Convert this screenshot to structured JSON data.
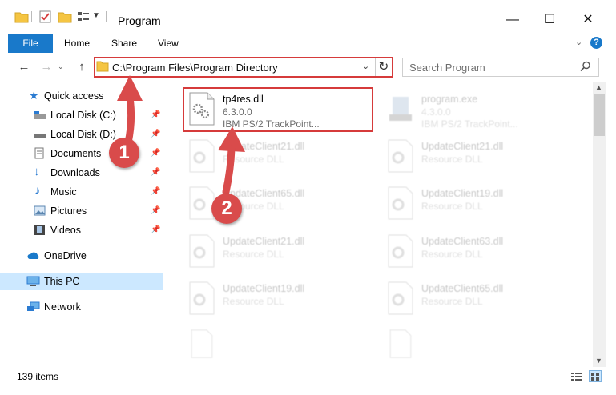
{
  "window": {
    "title": "Program",
    "minimize": "—",
    "maximize": "☐",
    "close": "✕"
  },
  "ribbon": {
    "file": "File",
    "home": "Home",
    "share": "Share",
    "view": "View",
    "help": "?"
  },
  "nav": {
    "back": "←",
    "forward": "→",
    "up": "↑",
    "address": "C:\\Program Files\\Program Directory",
    "refresh": "↻",
    "search_placeholder": "Search Program"
  },
  "sidebar": {
    "items": [
      {
        "label": "Quick access"
      },
      {
        "label": "Local Disk (C:)"
      },
      {
        "label": "Local Disk (D:)"
      },
      {
        "label": "Documents"
      },
      {
        "label": "Downloads"
      },
      {
        "label": "Music"
      },
      {
        "label": "Pictures"
      },
      {
        "label": "Videos"
      },
      {
        "label": "OneDrive"
      },
      {
        "label": "This PC"
      },
      {
        "label": "Network"
      }
    ]
  },
  "files": [
    {
      "name": "tp4res.dll",
      "line2": "6.3.0.0",
      "line3": "IBM PS/2 TrackPoint..."
    },
    {
      "name": "program.exe",
      "line2": "4.3.0.0",
      "line3": "IBM PS/2 TrackPoint..."
    },
    {
      "name": "UpdateClient21.dll",
      "line2": "Resource DLL"
    },
    {
      "name": "UpdateClient21.dll",
      "line2": "Resource DLL"
    },
    {
      "name": "UpdateClient65.dll",
      "line2": "Resource DLL"
    },
    {
      "name": "UpdateClient19.dll",
      "line2": "Resource DLL"
    },
    {
      "name": "UpdateClient21.dll",
      "line2": "Resource DLL"
    },
    {
      "name": "UpdateClient63.dll",
      "line2": "Resource DLL"
    },
    {
      "name": "UpdateClient19.dll",
      "line2": "Resource DLL"
    },
    {
      "name": "UpdateClient65.dll",
      "line2": "Resource DLL"
    }
  ],
  "status": {
    "items": "139 items"
  },
  "markers": {
    "one": "1",
    "two": "2"
  },
  "colors": {
    "accent": "#1979ca",
    "highlight": "#d63b3b",
    "selected_nav": "#cce8ff"
  }
}
